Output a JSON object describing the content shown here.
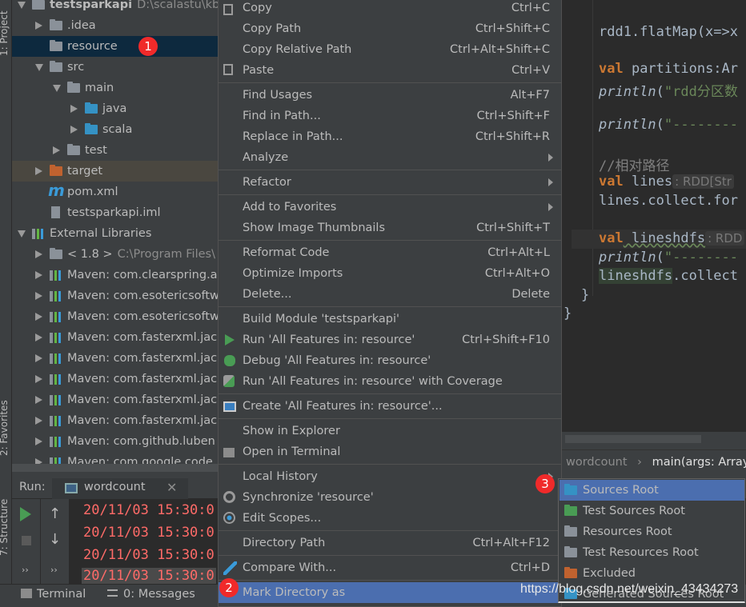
{
  "tool_strip": {
    "project": "1: Project",
    "favorites": "2: Favorites",
    "structure": "7: Structure"
  },
  "project_tree": [
    {
      "label": "testsparkapi",
      "path": "D:\\scalastu\\kb0",
      "level": 0,
      "arrow": "down",
      "icon": "module-icon",
      "bold": true
    },
    {
      "label": ".idea",
      "level": 1,
      "arrow": "right",
      "icon": "folder-icon"
    },
    {
      "label": "resource",
      "level": 1,
      "arrow": "none",
      "icon": "folder-icon",
      "selected": true
    },
    {
      "label": "src",
      "level": 1,
      "arrow": "down",
      "icon": "folder-icon"
    },
    {
      "label": "main",
      "level": 2,
      "arrow": "down",
      "icon": "folder-icon"
    },
    {
      "label": "java",
      "level": 3,
      "arrow": "right",
      "icon": "source-folder-icon"
    },
    {
      "label": "scala",
      "level": 3,
      "arrow": "right",
      "icon": "source-folder-icon"
    },
    {
      "label": "test",
      "level": 2,
      "arrow": "right",
      "icon": "folder-icon"
    },
    {
      "label": "target",
      "level": 1,
      "arrow": "right",
      "icon": "excluded-folder-icon",
      "excluded": true
    },
    {
      "label": "pom.xml",
      "level": 1,
      "arrow": "none",
      "icon": "maven-icon"
    },
    {
      "label": "testsparkapi.iml",
      "level": 1,
      "arrow": "none",
      "icon": "file-icon"
    },
    {
      "label": "External Libraries",
      "level": 0,
      "arrow": "down",
      "icon": "library-icon"
    },
    {
      "label": "< 1.8 >",
      "path": "C:\\Program Files\\",
      "level": 1,
      "arrow": "right",
      "icon": "jdk-icon"
    },
    {
      "label": "Maven: com.clearspring.a",
      "level": 1,
      "arrow": "right",
      "icon": "library-icon"
    },
    {
      "label": "Maven: com.esotericsoftw",
      "level": 1,
      "arrow": "right",
      "icon": "library-icon"
    },
    {
      "label": "Maven: com.esotericsoftw",
      "level": 1,
      "arrow": "right",
      "icon": "library-icon"
    },
    {
      "label": "Maven: com.fasterxml.jack",
      "level": 1,
      "arrow": "right",
      "icon": "library-icon"
    },
    {
      "label": "Maven: com.fasterxml.jack",
      "level": 1,
      "arrow": "right",
      "icon": "library-icon"
    },
    {
      "label": "Maven: com.fasterxml.jack",
      "level": 1,
      "arrow": "right",
      "icon": "library-icon"
    },
    {
      "label": "Maven: com.fasterxml.jack",
      "level": 1,
      "arrow": "right",
      "icon": "library-icon"
    },
    {
      "label": "Maven: com.fasterxml.jack",
      "level": 1,
      "arrow": "right",
      "icon": "library-icon"
    },
    {
      "label": "Maven: com.github.luben",
      "level": 1,
      "arrow": "right",
      "icon": "library-icon"
    },
    {
      "label": "Maven: com.google.code",
      "level": 1,
      "arrow": "right",
      "icon": "library-icon"
    }
  ],
  "editor": {
    "lines": [
      [
        {
          "t": "rdd1.flatMap(x=>x"
        }
      ],
      [
        {
          "t": "val",
          "c": "kw"
        },
        {
          "t": " partitions:Ar"
        }
      ],
      [
        {
          "t": "println",
          "c": "it"
        },
        {
          "t": "("
        },
        {
          "t": "\"rdd分区数",
          "c": "str"
        }
      ],
      [
        {
          "t": "println",
          "c": "it"
        },
        {
          "t": "("
        },
        {
          "t": "\"--------",
          "c": "str"
        }
      ],
      [
        {
          "t": "//相对路径",
          "c": "cm"
        }
      ],
      [
        {
          "t": "val",
          "c": "kw"
        },
        {
          "t": " lines"
        },
        {
          "t": ": RDD[Str",
          "c": "hint"
        }
      ],
      [
        {
          "t": "lines.collect.for"
        }
      ],
      [
        {
          "t": "val",
          "c": "kw"
        },
        {
          "t": " lineshdfs"
        },
        {
          "t": ": RDD",
          "c": "hint"
        }
      ],
      [
        {
          "t": "println",
          "c": "it"
        },
        {
          "t": "("
        },
        {
          "t": "\"--------",
          "c": "str"
        }
      ],
      [
        {
          "t": "lineshdfs"
        },
        {
          "t": ".collect"
        }
      ],
      [
        {
          "t": "}"
        }
      ],
      [
        {
          "t": "}"
        }
      ]
    ]
  },
  "breadcrumb": {
    "file": "wordcount",
    "method": "main(args: Array"
  },
  "run_panel": {
    "label": "Run:",
    "tab": "wordcount",
    "console_lines": [
      "20/11/03 15:30:0",
      "20/11/03 15:30:0",
      "20/11/03 15:30:0",
      "20/11/03 15:30:0"
    ]
  },
  "bottom_bar": {
    "terminal": "Terminal",
    "messages": "0: Messages"
  },
  "context_menu": {
    "groups": [
      [
        {
          "label": "Copy",
          "key": "Ctrl+C",
          "icon": "copy-icon"
        },
        {
          "label": "Copy Path",
          "key": "Ctrl+Shift+C"
        },
        {
          "label": "Copy Relative Path",
          "key": "Ctrl+Alt+Shift+C"
        },
        {
          "label": "Paste",
          "key": "Ctrl+V",
          "icon": "paste-icon"
        }
      ],
      [
        {
          "label": "Find Usages",
          "key": "Alt+F7"
        },
        {
          "label": "Find in Path...",
          "key": "Ctrl+Shift+F"
        },
        {
          "label": "Replace in Path...",
          "key": "Ctrl+Shift+R"
        },
        {
          "label": "Analyze",
          "submenu": true
        }
      ],
      [
        {
          "label": "Refactor",
          "submenu": true
        }
      ],
      [
        {
          "label": "Add to Favorites",
          "submenu": true
        },
        {
          "label": "Show Image Thumbnails",
          "key": "Ctrl+Shift+T"
        }
      ],
      [
        {
          "label": "Reformat Code",
          "key": "Ctrl+Alt+L"
        },
        {
          "label": "Optimize Imports",
          "key": "Ctrl+Alt+O"
        },
        {
          "label": "Delete...",
          "key": "Delete"
        }
      ],
      [
        {
          "label": "Build Module 'testsparkapi'"
        },
        {
          "label": "Run 'All Features in: resource'",
          "key": "Ctrl+Shift+F10",
          "icon": "run-icon"
        },
        {
          "label": "Debug 'All Features in: resource'",
          "icon": "debug-icon"
        },
        {
          "label": "Run 'All Features in: resource' with Coverage",
          "icon": "coverage-icon"
        }
      ],
      [
        {
          "label": "Create 'All Features in: resource'...",
          "icon": "create-config-icon"
        }
      ],
      [
        {
          "label": "Show in Explorer"
        },
        {
          "label": "Open in Terminal",
          "icon": "terminal-icon"
        }
      ],
      [
        {
          "label": "Local History",
          "submenu": true
        },
        {
          "label": "Synchronize 'resource'",
          "icon": "sync-icon"
        },
        {
          "label": "Edit Scopes...",
          "icon": "scope-icon"
        }
      ],
      [
        {
          "label": "Directory Path",
          "key": "Ctrl+Alt+F12"
        }
      ],
      [
        {
          "label": "Compare With...",
          "key": "Ctrl+D",
          "icon": "compare-icon"
        }
      ],
      [
        {
          "label": "Mark Directory as",
          "submenu": true,
          "highlighted": true
        }
      ]
    ]
  },
  "submenu": {
    "items": [
      {
        "label": "Sources Root",
        "icon": "sources-root-icon",
        "color": "#3592c4",
        "highlighted": true
      },
      {
        "label": "Test Sources Root",
        "icon": "test-sources-root-icon",
        "color": "#499c54"
      },
      {
        "label": "Resources Root",
        "icon": "resources-root-icon",
        "color": "#8a9199"
      },
      {
        "label": "Test Resources Root",
        "icon": "test-resources-root-icon",
        "color": "#8a9199"
      },
      {
        "label": "Excluded",
        "icon": "excluded-icon",
        "color": "#c0622f"
      },
      {
        "label": "Generated Sources Root",
        "icon": "generated-sources-root-icon",
        "color": "#3592c4"
      }
    ]
  },
  "annotations": [
    "1",
    "2",
    "3"
  ],
  "watermark": "https://blog.csdn.net/weixin_43434273",
  "colors": {
    "selection": "#4b6eaf",
    "tree_selection": "#0d293e",
    "badge": "#f02a2a",
    "console_error": "#ff6b68"
  }
}
